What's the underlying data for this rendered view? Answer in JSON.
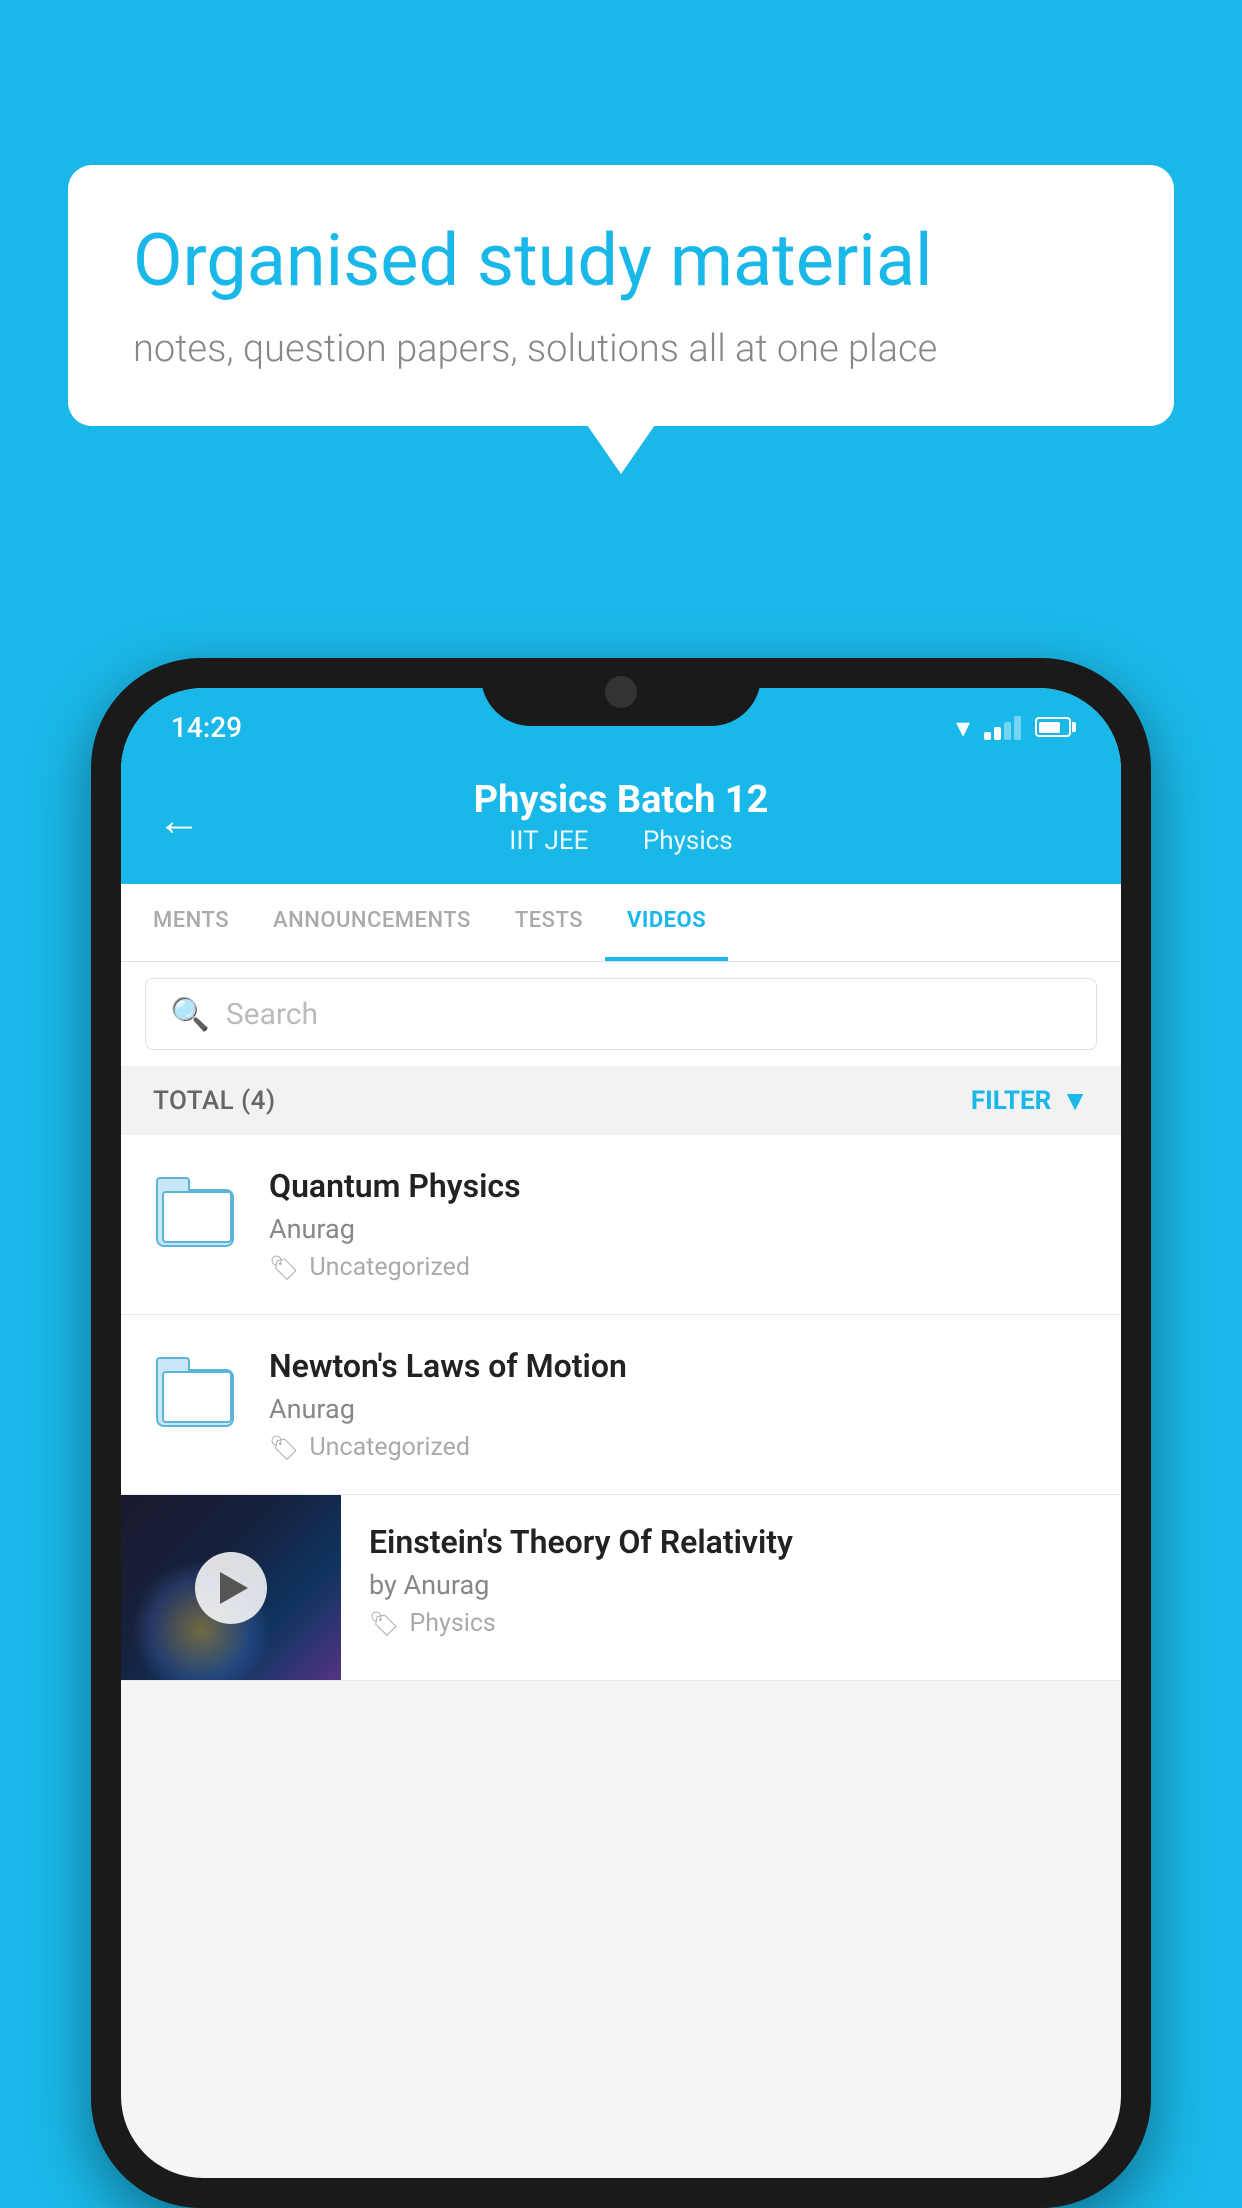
{
  "background": {
    "color": "#1ab8e8"
  },
  "hero": {
    "title": "Organised study material",
    "subtitle": "notes, question papers, solutions all at one place"
  },
  "phone": {
    "status_bar": {
      "time": "14:29"
    },
    "header": {
      "back_label": "←",
      "title": "Physics Batch 12",
      "subtitle_part1": "IIT JEE",
      "subtitle_part2": "Physics"
    },
    "tabs": [
      {
        "label": "MENTS",
        "active": false
      },
      {
        "label": "ANNOUNCEMENTS",
        "active": false
      },
      {
        "label": "TESTS",
        "active": false
      },
      {
        "label": "VIDEOS",
        "active": true
      }
    ],
    "search": {
      "placeholder": "Search"
    },
    "filter_bar": {
      "total_label": "TOTAL (4)",
      "filter_label": "FILTER"
    },
    "videos": [
      {
        "title": "Quantum Physics",
        "author": "Anurag",
        "tag": "Uncategorized",
        "type": "folder"
      },
      {
        "title": "Newton's Laws of Motion",
        "author": "Anurag",
        "tag": "Uncategorized",
        "type": "folder"
      },
      {
        "title": "Einstein's Theory Of Relativity",
        "author": "by Anurag",
        "tag": "Physics",
        "type": "video"
      }
    ]
  }
}
